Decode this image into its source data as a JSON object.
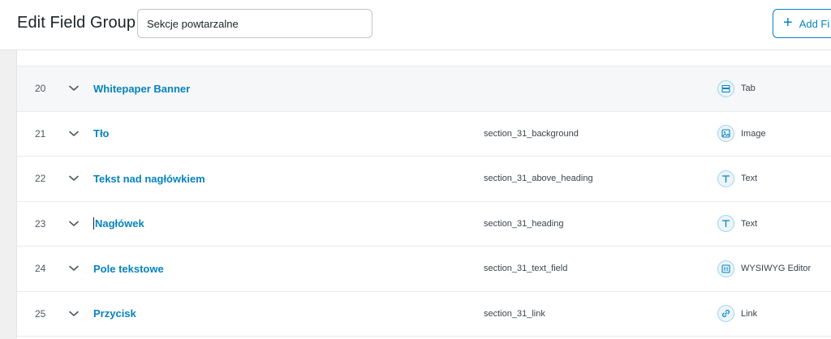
{
  "header": {
    "title": "Edit Field Group",
    "group_title_value": "Sekcje powtarzalne",
    "add_field_label": "Add Fi"
  },
  "fields": [
    {
      "order": "20",
      "label": "Whitepaper Banner",
      "name": "",
      "type": "Tab",
      "icon": "tab-icon"
    },
    {
      "order": "21",
      "label": "Tło",
      "name": "section_31_background",
      "type": "Image",
      "icon": "image-icon"
    },
    {
      "order": "22",
      "label": "Tekst nad nagłówkiem",
      "name": "section_31_above_heading",
      "type": "Text",
      "icon": "text-icon"
    },
    {
      "order": "23",
      "label": "Nagłówek",
      "name": "section_31_heading",
      "type": "Text",
      "icon": "text-icon"
    },
    {
      "order": "24",
      "label": "Pole tekstowe",
      "name": "section_31_text_field",
      "type": "WYSIWYG Editor",
      "icon": "wysiwyg-icon"
    },
    {
      "order": "25",
      "label": "Przycisk",
      "name": "section_31_link",
      "type": "Link",
      "icon": "link-icon"
    }
  ],
  "colors": {
    "accent": "#0783be",
    "icon_bg": "#ebf5fa",
    "text": "#1d2327"
  }
}
